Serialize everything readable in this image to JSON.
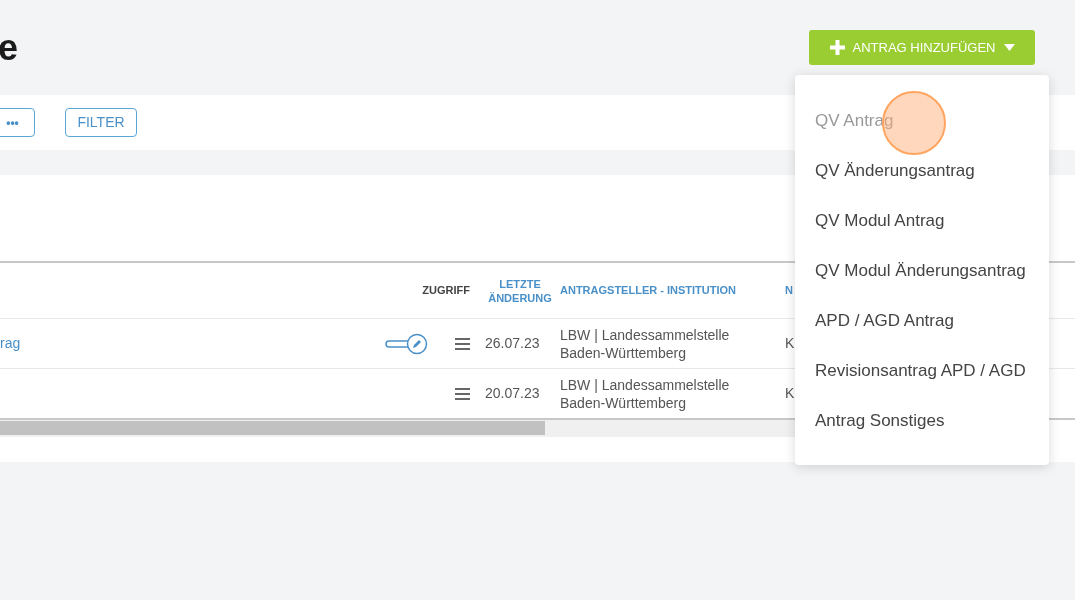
{
  "page_title": "e",
  "toolbar": {
    "more_button": "•••",
    "filter_button": "FILTER"
  },
  "table": {
    "columns": [
      {
        "label": "ZUGRIFF",
        "kind": "plain"
      },
      {
        "label": "LETZTE ÄNDERUNG",
        "kind": "link"
      },
      {
        "label": "ANTRAGSTELLER - INSTITUTION",
        "kind": "link"
      },
      {
        "label": "N",
        "kind": "link"
      }
    ],
    "rows": [
      {
        "name": "rag",
        "edit_toggle": true,
        "date": "26.07.23",
        "institution": "LBW | Landessammelstelle Baden-Württemberg",
        "column_5": "K"
      },
      {
        "name": "",
        "edit_toggle": false,
        "date": "20.07.23",
        "institution": "LBW | Landessammelstelle Baden-Württemberg",
        "column_5": "K"
      }
    ]
  },
  "add_button": {
    "label": "ANTRAG HINZUFÜGEN",
    "expanded": true
  },
  "menu": [
    {
      "label": "QV Antrag",
      "selected": true
    },
    {
      "label": "QV Änderungsantrag",
      "selected": false
    },
    {
      "label": "QV Modul Antrag",
      "selected": false
    },
    {
      "label": "QV Modul Änderungsantrag",
      "selected": false
    },
    {
      "label": "APD / AGD Antrag",
      "selected": false
    },
    {
      "label": "Revisionsantrag APD / AGD",
      "selected": false
    },
    {
      "label": "Antrag Sonstiges",
      "selected": false
    }
  ]
}
